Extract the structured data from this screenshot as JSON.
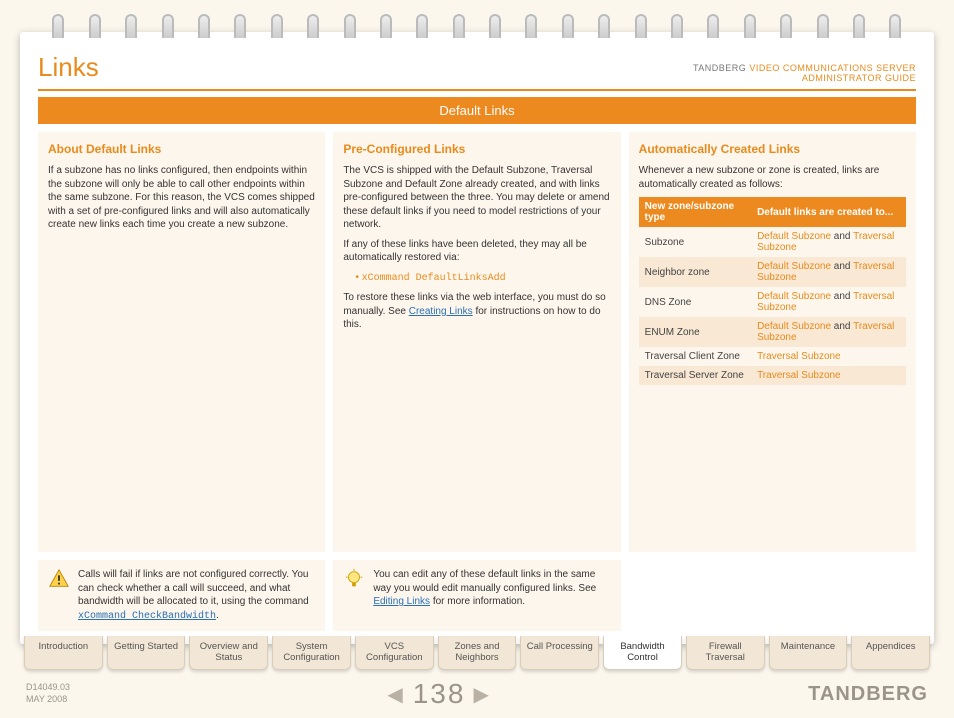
{
  "header": {
    "title": "Links",
    "brand": "TANDBERG",
    "product": "VIDEO COMMUNICATIONS SERVER",
    "subtitle": "ADMINISTRATOR GUIDE"
  },
  "banner": "Default Links",
  "col1": {
    "heading": "About Default Links",
    "p1": "If a subzone has no links configured, then endpoints within the subzone will only be able to call other endpoints within the same subzone. For this reason, the VCS comes shipped with a set of pre-configured links and will also automatically create new links each time you create a new subzone."
  },
  "col2": {
    "heading": "Pre-Configured Links",
    "p1": "The VCS is shipped with the Default Subzone, Traversal Subzone and Default Zone already created, and with links pre-configured between the three. You may delete or amend these default links if you need to model restrictions of your network.",
    "p2": "If any of these links have been deleted, they may all be automatically restored via:",
    "cmd": "xCommand DefaultLinksAdd",
    "p3a": "To restore these links via the web interface, you must do so manually. See ",
    "p3link": "Creating Links",
    "p3b": " for instructions on how to do this."
  },
  "col3": {
    "heading": "Automatically Created Links",
    "intro": "Whenever a new subzone or zone is created, links are automatically created as follows:",
    "th1": "New zone/subzone type",
    "th2": "Default links are created to...",
    "rows": [
      {
        "type": "Subzone",
        "a": "Default Subzone",
        "and": " and ",
        "b": "Traversal Subzone"
      },
      {
        "type": "Neighbor zone",
        "a": "Default Subzone",
        "and": " and ",
        "b": "Traversal Subzone"
      },
      {
        "type": "DNS Zone",
        "a": "Default Subzone",
        "and": " and ",
        "b": "Traversal Subzone"
      },
      {
        "type": "ENUM Zone",
        "a": "Default Subzone",
        "and": " and ",
        "b": "Traversal Subzone"
      },
      {
        "type": "Traversal Client Zone",
        "a": "Traversal Subzone",
        "and": "",
        "b": ""
      },
      {
        "type": "Traversal Server Zone",
        "a": "Traversal Subzone",
        "and": "",
        "b": ""
      }
    ]
  },
  "tip1": {
    "textA": "Calls will fail if links are not configured correctly. You can check whether a call will succeed, and what bandwidth will be allocated to it, using the command ",
    "cmd": "xCommand CheckBandwidth",
    "textB": "."
  },
  "tip2": {
    "textA": "You can edit any of these default links in the same way you would edit manually configured links. See ",
    "link": "Editing Links",
    "textB": " for more information."
  },
  "tabs": [
    "Introduction",
    "Getting Started",
    "Overview and Status",
    "System Configuration",
    "VCS Configuration",
    "Zones and Neighbors",
    "Call Processing",
    "Bandwidth Control",
    "Firewall Traversal",
    "Maintenance",
    "Appendices"
  ],
  "active_tab_index": 7,
  "footer": {
    "docid": "D14049.03",
    "date": "MAY 2008",
    "page": "138",
    "logo": "TANDBERG"
  }
}
